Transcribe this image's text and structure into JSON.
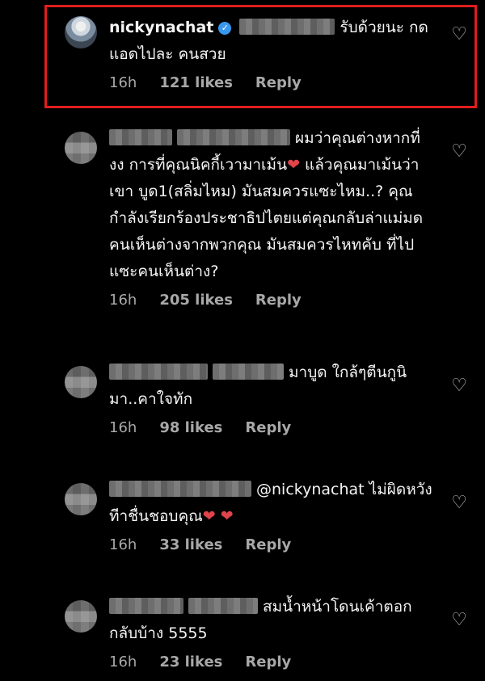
{
  "comments": [
    {
      "username": "nickynachat",
      "verified": true,
      "text_after": "รับด้วยนะ กดแอดไปละ คนสวย",
      "time": "16h",
      "likes": "121 likes",
      "reply": "Reply"
    },
    {
      "text": "ผมว่าคุณต่างหากที่ งง การที่คุณนิคกี้เวามาเม้น",
      "text_2": "แล้วคุณมาเม้นว่าเขา บูด1(สลิ่มไหม) มันสมควรแซะไหม..? คุณกำลังเรียกร้องประชาธิปไตยแต่คุณกลับล่าแม่มดคนเห็นต่างจากพวกคุณ มันสมควรไหทคับ ที่ไปแซะคนเห็นต่าง?",
      "time": "16h",
      "likes": "205 likes",
      "reply": "Reply"
    },
    {
      "text": "มาบูด ใกล้ๆตีนกูนิมา..คาใจทัก",
      "time": "16h",
      "likes": "98 likes",
      "reply": "Reply"
    },
    {
      "text": "@nickynachat ไม่ผิดหวังทีาชื่นชอบคุณ",
      "time": "16h",
      "likes": "33 likes",
      "reply": "Reply"
    },
    {
      "text": "สมน้ำหน้าโดนเค้าตอกกลับบ้าง 5555",
      "time": "16h",
      "likes": "23 likes",
      "reply": "Reply"
    }
  ],
  "icons": {
    "heart_outline": "♡",
    "red_heart": "❤"
  },
  "colors": {
    "highlight": "#e11d1d",
    "meta": "#a8a8a8",
    "background": "#000000"
  }
}
